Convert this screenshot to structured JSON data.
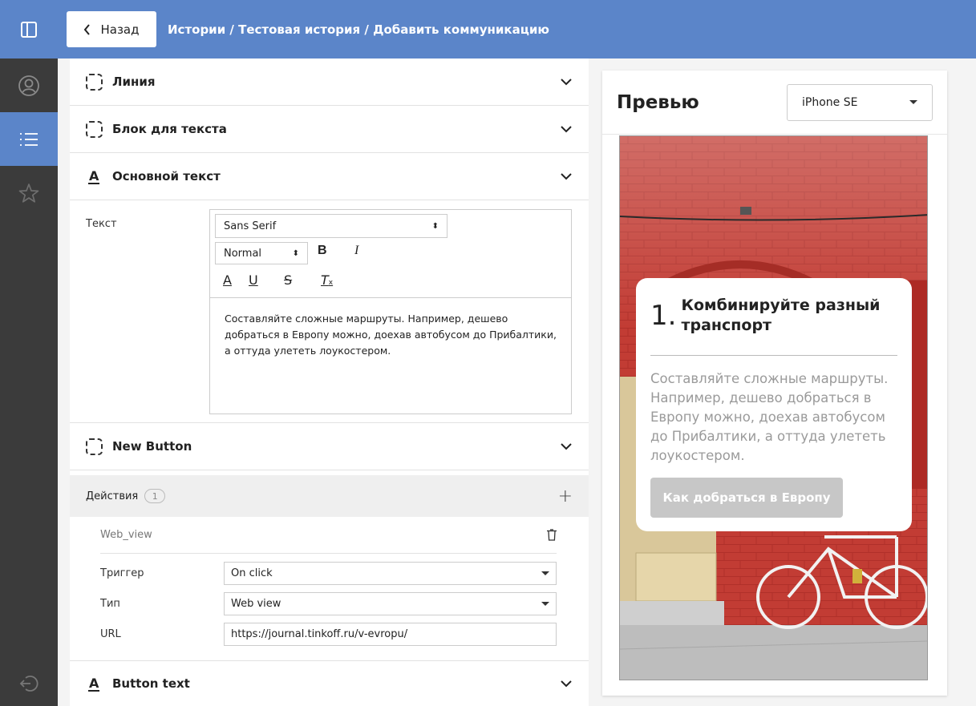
{
  "header": {
    "back_label": "Назад",
    "breadcrumb": "Истории / Тестовая история / Добавить коммуникацию"
  },
  "sidebar": {
    "items": [
      {
        "icon": "panel-icon"
      },
      {
        "icon": "user-icon"
      },
      {
        "icon": "list-icon",
        "active": true
      },
      {
        "icon": "star-icon"
      }
    ],
    "bottom_icon": "logout-icon"
  },
  "editor": {
    "sections": {
      "line": "Линия",
      "text_block": "Блок для текста",
      "main_text": "Основной текст",
      "new_button": "New Button",
      "button_text": "Button text"
    },
    "text_field": {
      "label": "Текст",
      "font": "Sans Serif",
      "size": "Normal",
      "content": "Составляйте сложные маршруты. Например, дешево добраться в Европу можно, доехав автобусом до Прибалтики, а оттуда улететь лоукостером."
    },
    "actions": {
      "label": "Действия",
      "count": "1",
      "item": {
        "title": "Web_view",
        "trigger_label": "Триггер",
        "trigger_value": "On click",
        "type_label": "Тип",
        "type_value": "Web view",
        "url_label": "URL",
        "url_value": "https://journal.tinkoff.ru/v-evropu/"
      }
    }
  },
  "preview": {
    "title": "Превью",
    "device": "iPhone SE",
    "card": {
      "number": "1.",
      "heading": "Комбинируйте разный транспорт",
      "body": "Составляйте сложные маршруты. Например, дешево добраться в Европу можно, доехав автобусом до Прибалтики, а оттуда улететь лоукостером.",
      "button": "Как добраться в Европу"
    }
  },
  "colors": {
    "accent": "#5b85c9",
    "rail": "#3b3b3b",
    "brick": "#c23c34"
  }
}
